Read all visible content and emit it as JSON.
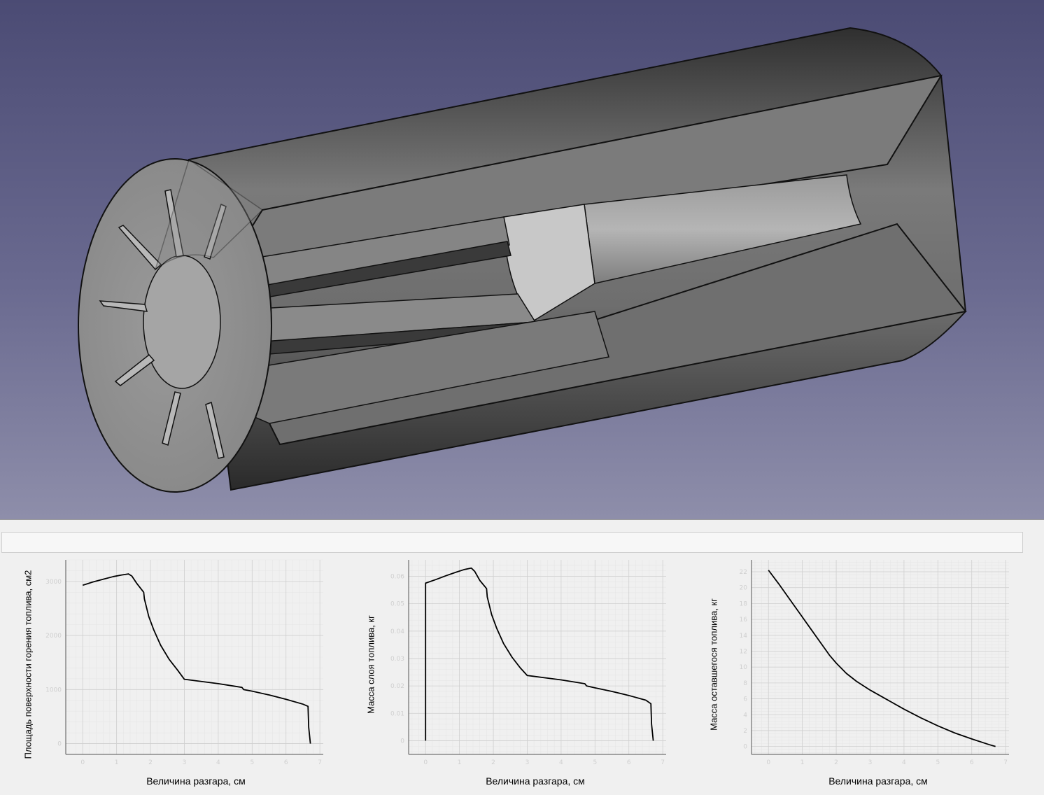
{
  "viewport": {
    "background_top": "#4b4b74",
    "background_bottom": "#8e8eaa",
    "model_color": "#8c8c8c"
  },
  "status_bar": {
    "text": ""
  },
  "plots": [
    {
      "xlabel": "Величина разгара, см",
      "ylabel": "Площадь поверхности горения топлива, см2"
    },
    {
      "xlabel": "Величина разгара, см",
      "ylabel": "Масса слоя топлива, кг"
    },
    {
      "xlabel": "Величина разгара, см",
      "ylabel": "Масса оставшегося топлива, кг"
    }
  ],
  "chart_data": [
    {
      "type": "line",
      "xlabel": "Величина разгара, см",
      "ylabel": "Площадь поверхности горения топлива, см2",
      "xlim": [
        -0.5,
        7.1
      ],
      "ylim": [
        -200,
        3400
      ],
      "x_ticks": [
        0,
        1,
        2,
        3,
        4,
        5,
        6,
        7
      ],
      "y_ticks": [
        0,
        1000,
        2000,
        3000
      ],
      "grid": true,
      "series": [
        {
          "x": [
            0,
            0.3,
            0.6,
            0.9,
            1.15,
            1.35,
            1.45,
            1.6,
            1.8,
            1.82,
            1.95,
            2.1,
            2.3,
            2.55,
            2.8,
            3.0,
            3.5,
            4.0,
            4.5,
            4.7,
            4.75,
            5.0,
            5.5,
            6.0,
            6.5,
            6.65,
            6.67,
            6.72
          ],
          "y": [
            2930,
            2990,
            3040,
            3090,
            3120,
            3140,
            3100,
            2960,
            2800,
            2680,
            2350,
            2100,
            1820,
            1560,
            1360,
            1190,
            1150,
            1110,
            1060,
            1040,
            1000,
            970,
            900,
            820,
            730,
            690,
            300,
            0
          ]
        }
      ]
    },
    {
      "type": "line",
      "xlabel": "Величина разгара, см",
      "ylabel": "Масса слоя топлива, кг",
      "xlim": [
        -0.5,
        7.1
      ],
      "ylim": [
        -0.005,
        0.066
      ],
      "x_ticks": [
        0,
        1,
        2,
        3,
        4,
        5,
        6,
        7
      ],
      "y_ticks": [
        0,
        0.01,
        0.02,
        0.03,
        0.04,
        0.05,
        0.06
      ],
      "grid": true,
      "series": [
        {
          "x": [
            0,
            0,
            0.3,
            0.6,
            0.9,
            1.15,
            1.35,
            1.45,
            1.6,
            1.8,
            1.82,
            1.95,
            2.1,
            2.3,
            2.55,
            2.8,
            3.0,
            3.5,
            4.0,
            4.5,
            4.7,
            4.75,
            5.0,
            5.5,
            6.0,
            6.5,
            6.65,
            6.67,
            6.72
          ],
          "y": [
            0,
            0.0575,
            0.0588,
            0.0602,
            0.0615,
            0.0625,
            0.063,
            0.0618,
            0.0585,
            0.0555,
            0.0525,
            0.046,
            0.041,
            0.0355,
            0.0305,
            0.0265,
            0.0238,
            0.023,
            0.0222,
            0.0212,
            0.0208,
            0.02,
            0.0193,
            0.018,
            0.0165,
            0.0148,
            0.0135,
            0.006,
            0
          ]
        }
      ]
    },
    {
      "type": "line",
      "xlabel": "Величина разгара, см",
      "ylabel": "Масса оставшегося топлива, кг",
      "xlim": [
        -0.5,
        7.1
      ],
      "ylim": [
        -1,
        23.5
      ],
      "x_ticks": [
        0,
        1,
        2,
        3,
        4,
        5,
        6,
        7
      ],
      "y_ticks": [
        0,
        2,
        4,
        6,
        8,
        10,
        12,
        14,
        16,
        18,
        20,
        22
      ],
      "grid": true,
      "series": [
        {
          "x": [
            0,
            0.3,
            0.6,
            0.9,
            1.2,
            1.5,
            1.8,
            2.0,
            2.3,
            2.6,
            3.0,
            3.5,
            4.0,
            4.5,
            5.0,
            5.5,
            6.0,
            6.5,
            6.7
          ],
          "y": [
            22.2,
            20.5,
            18.7,
            16.9,
            15.1,
            13.3,
            11.5,
            10.5,
            9.2,
            8.2,
            7.1,
            5.9,
            4.7,
            3.6,
            2.6,
            1.7,
            0.95,
            0.25,
            0
          ]
        }
      ]
    }
  ]
}
